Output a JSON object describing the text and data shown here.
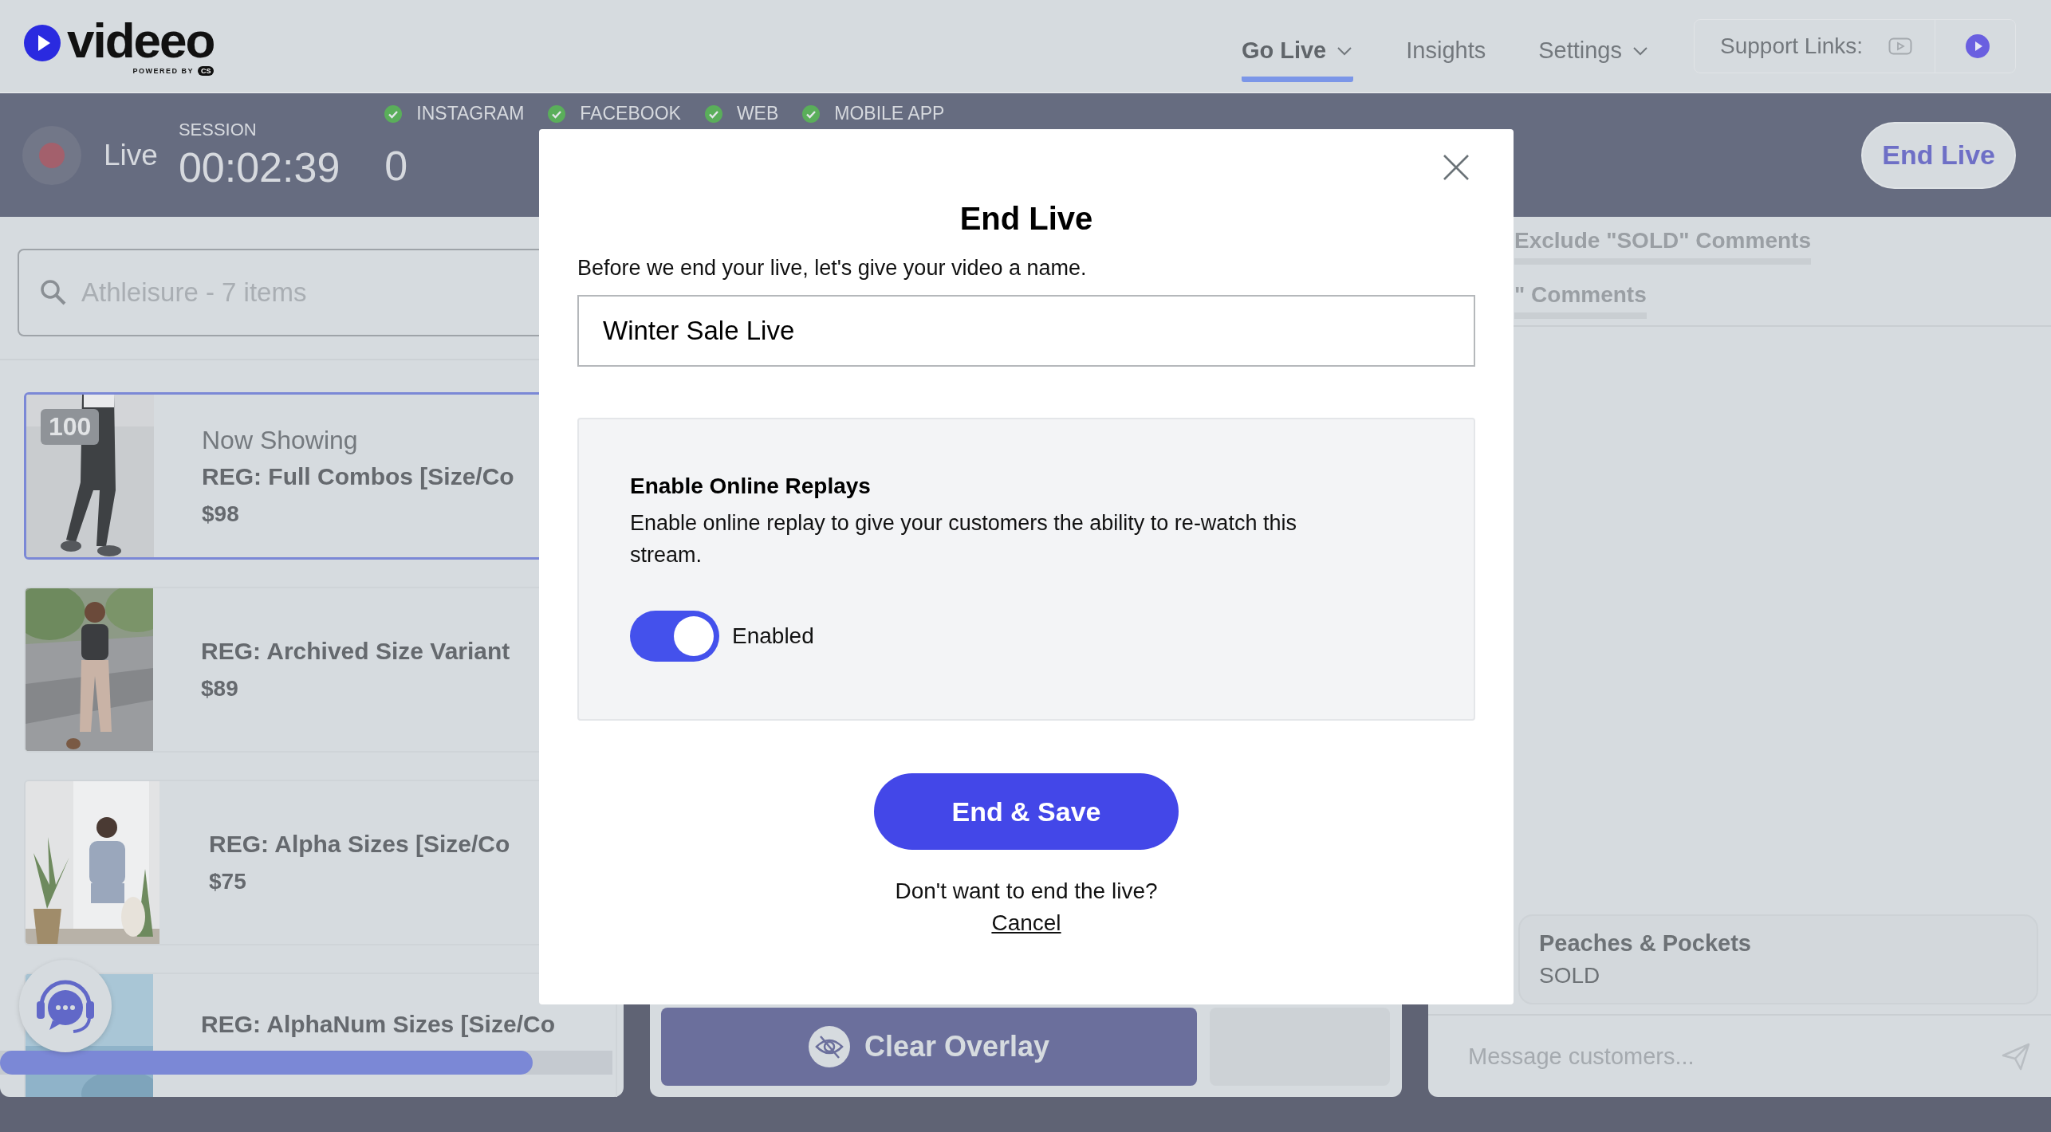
{
  "header": {
    "logo": {
      "name": "videeo",
      "tagline": "POWERED BY",
      "badge": "CS"
    },
    "nav": [
      {
        "label": "Go Live",
        "selected": true,
        "dropdown": true
      },
      {
        "label": "Insights",
        "selected": false,
        "dropdown": false
      },
      {
        "label": "Settings",
        "selected": false,
        "dropdown": true
      }
    ],
    "support_links": {
      "label": "Support Links:"
    }
  },
  "live_bar": {
    "status": "Live",
    "session_label": "SESSION",
    "session_time": "00:02:39",
    "platforms": [
      {
        "name": "INSTAGRAM",
        "connected": true
      },
      {
        "name": "FACEBOOK",
        "connected": true
      },
      {
        "name": "WEB",
        "connected": true
      },
      {
        "name": "MOBILE APP",
        "connected": true
      }
    ],
    "count": "0",
    "end_button": "End Live"
  },
  "products": {
    "search": {
      "placeholder": "Athleisure - 7 items"
    },
    "items": [
      {
        "badge": "100",
        "caption": "Now Showing",
        "title": "REG: Full Combos [Size/Co",
        "price": "$98",
        "selected": true
      },
      {
        "title": "REG: Archived Size Variant",
        "price": "$89",
        "selected": false
      },
      {
        "title": "REG: Alpha Sizes [Size/Co",
        "price": "$75",
        "selected": false
      },
      {
        "title": "REG: AlphaNum Sizes [Size/Co",
        "selected": false
      }
    ]
  },
  "overlay_controls": {
    "clear_button": "Clear Overlay"
  },
  "comments": {
    "tabs": [
      {
        "label": "Exclude \"SOLD\" Comments",
        "selected": false
      },
      {
        "label": "\" Comments",
        "selected": false
      }
    ],
    "messages": [
      {
        "author": "Peaches & Pockets",
        "text": "SOLD"
      }
    ],
    "composer": {
      "placeholder": "Message customers..."
    }
  },
  "dialog": {
    "title": "End Live",
    "prompt": "Before we end your live, let's give your video a name.",
    "name_field": {
      "value": "Winter Sale Live"
    },
    "replays": {
      "title": "Enable Online Replays",
      "description": "Enable online replay to give your customers the ability to re-watch this stream.",
      "toggle": {
        "on": true,
        "label": "Enabled"
      }
    },
    "primary_button": "End & Save",
    "cancel_prompt": "Don't want to end the live?",
    "cancel_link": "Cancel"
  }
}
